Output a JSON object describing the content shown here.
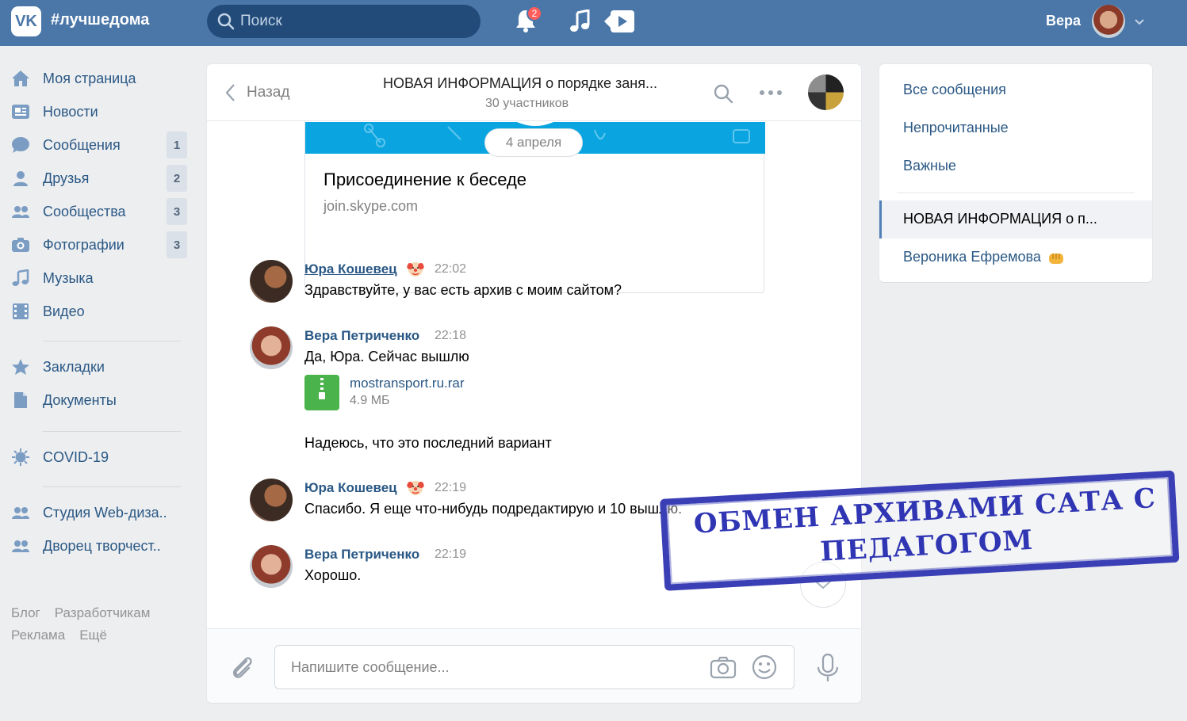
{
  "header": {
    "logo_text": "VK",
    "hashtag": "#лучшедома",
    "search_placeholder": "Поиск",
    "notifications_count": "2",
    "user_name": "Вера"
  },
  "sidebar": {
    "items": [
      {
        "label": "Моя страница",
        "count": "",
        "icon": "home-icon"
      },
      {
        "label": "Новости",
        "count": "",
        "icon": "news-icon"
      },
      {
        "label": "Сообщения",
        "count": "1",
        "icon": "chat-icon"
      },
      {
        "label": "Друзья",
        "count": "2",
        "icon": "friend-icon"
      },
      {
        "label": "Сообщества",
        "count": "3",
        "icon": "groups-icon"
      },
      {
        "label": "Фотографии",
        "count": "3",
        "icon": "camera-icon"
      },
      {
        "label": "Музыка",
        "count": "",
        "icon": "music-icon"
      },
      {
        "label": "Видео",
        "count": "",
        "icon": "video-icon"
      },
      {
        "label": "Закладки",
        "count": "",
        "icon": "star-icon"
      },
      {
        "label": "Документы",
        "count": "",
        "icon": "document-icon"
      },
      {
        "label": "COVID-19",
        "count": "",
        "icon": "virus-icon"
      },
      {
        "label": "Студия Web-диза..",
        "count": "",
        "icon": "groups-icon"
      },
      {
        "label": "Дворец творчест..",
        "count": "",
        "icon": "groups-icon"
      }
    ],
    "footer": [
      "Блог",
      "Разработчикам",
      "Реклама",
      "Ещё"
    ]
  },
  "chat": {
    "back_label": "Назад",
    "title": "НОВАЯ ИНФОРМАЦИЯ  о порядке заня...",
    "subtitle": "30 участников",
    "link_card": {
      "title": "Присоединение к беседе",
      "url": "join.skype.com"
    },
    "date_label": "4 апреля",
    "messages": [
      {
        "author": "Юра Кошевец",
        "time": "22:02",
        "text": "Здравствуйте, у вас есть архив с моим сайтом?"
      },
      {
        "author": "Вера Петриченко",
        "time": "22:18",
        "text": "Да, Юра. Сейчас вышлю"
      },
      {
        "author": "Юра Кошевец",
        "time": "22:19",
        "text": "Спасибо. Я еще что-нибудь подредактирую и 10 вышлю."
      },
      {
        "author": "Вера Петриченко",
        "time": "22:19",
        "text": "Хорошо."
      }
    ],
    "attachment": {
      "name": "mostransport.ru.rar",
      "size": "4.9 МБ"
    },
    "extra_text": "Надеюсь, что это последний вариант",
    "composer_placeholder": "Напишите сообщение..."
  },
  "right_panel": {
    "all_messages": "Все сообщения",
    "unread": "Непрочитанные",
    "important": "Важные",
    "active_conversation": "НОВАЯ ИНФОРМАЦИЯ  о п...",
    "other_conversation": "Вероника Ефремова"
  },
  "stamp": {
    "text": "ОБМЕН АРХИВАМИ САТА С ПЕДАГОГОМ",
    "color": "#2f35b3"
  },
  "colors": {
    "accent": "#4a76a8",
    "link": "#2a5885",
    "badge": "#ff5c5c"
  }
}
